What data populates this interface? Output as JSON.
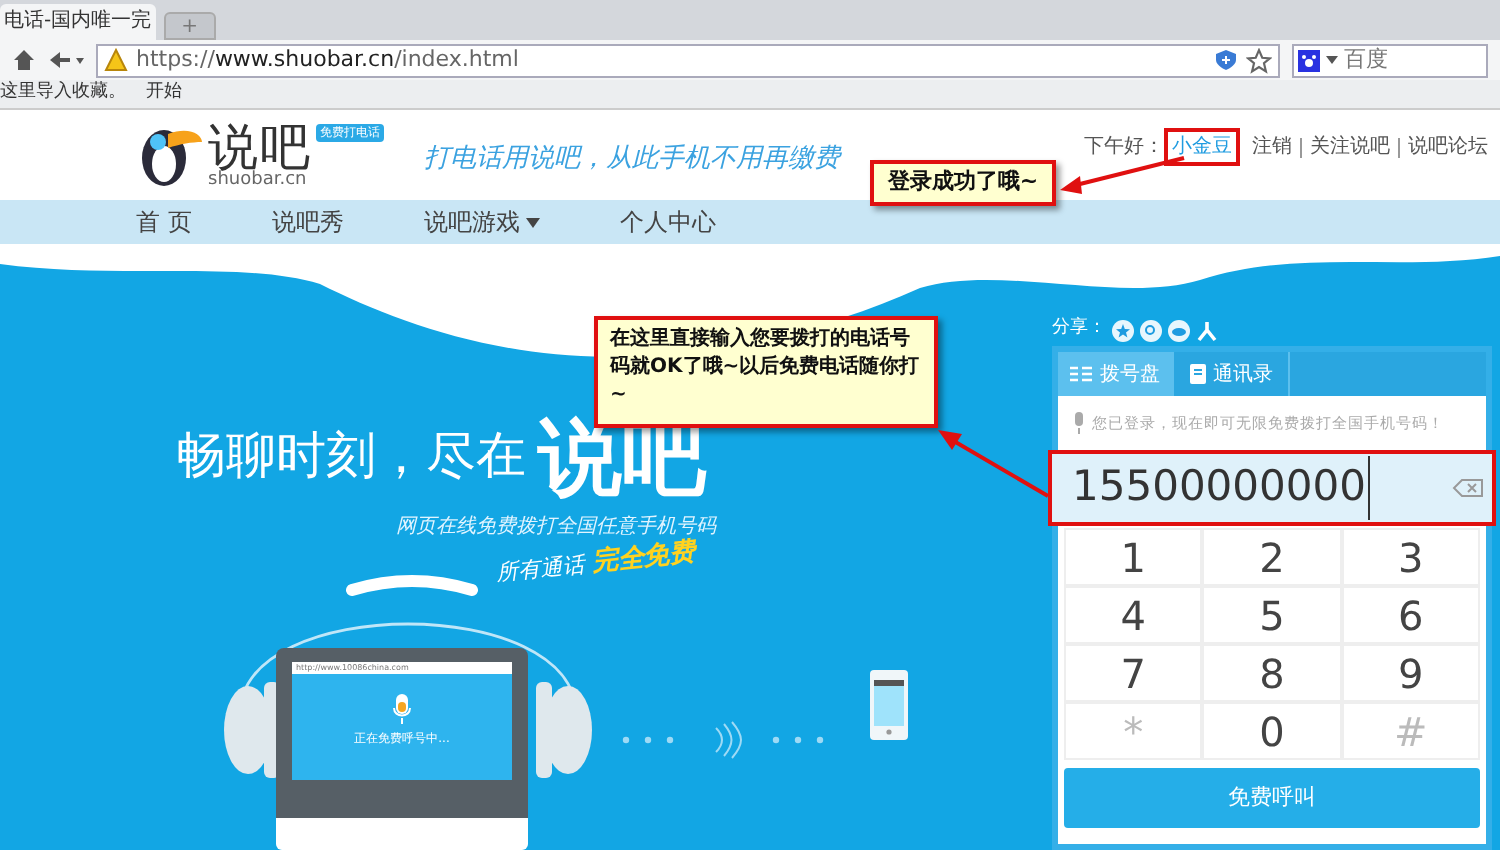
{
  "browser": {
    "tabs": [
      {
        "label": "电话-国内唯一完",
        "selected": true
      },
      {
        "label": "+",
        "selected": false
      }
    ],
    "url": "https://**www.shuobar.cn**/index.html",
    "search_engine": "百度",
    "bookmarks": [
      "这里导入收藏。",
      "开始"
    ]
  },
  "header": {
    "logo_text": "说吧",
    "logo_domain": "shuobar.cn",
    "badge": "免费打电话",
    "slogan": "打电话用说吧，从此手机不用再缴费",
    "greeting": "下午好：",
    "username": "小金豆",
    "links": [
      "注销",
      "关注说吧",
      "说吧论坛"
    ]
  },
  "nav": [
    {
      "label": "首 页",
      "dropdown": false
    },
    {
      "label": "说吧秀",
      "dropdown": false
    },
    {
      "label": "说吧游戏",
      "dropdown": true
    },
    {
      "label": "个人中心",
      "dropdown": false
    }
  ],
  "hero": {
    "headline": "畅聊时刻，尽在",
    "brand": "说吧",
    "subtitle": "网页在线免费拨打全国任意手机号码",
    "tagline": "所有通话",
    "tagline_highlight": "完全免费",
    "screen_url": "http://www.10086china.com",
    "screen_status": "正在免费呼号中..."
  },
  "dialer": {
    "share_label": "分享：",
    "tabs": [
      {
        "label": "拨号盘",
        "selected": true
      },
      {
        "label": "通讯录",
        "selected": false
      }
    ],
    "hint": "您已登录，现在即可无限免费拨打全国手机号码！",
    "number": "15500000000",
    "keys": [
      {
        "label": "1",
        "kind": "digit"
      },
      {
        "label": "2",
        "kind": "digit"
      },
      {
        "label": "3",
        "kind": "digit"
      },
      {
        "label": "4",
        "kind": "digit"
      },
      {
        "label": "5",
        "kind": "digit"
      },
      {
        "label": "6",
        "kind": "digit"
      },
      {
        "label": "7",
        "kind": "digit"
      },
      {
        "label": "8",
        "kind": "digit"
      },
      {
        "label": "9",
        "kind": "digit"
      },
      {
        "label": "*",
        "kind": "symbol"
      },
      {
        "label": "0",
        "kind": "digit"
      },
      {
        "label": "#",
        "kind": "symbol"
      }
    ],
    "call_button": "免费呼叫"
  },
  "annotations": {
    "login": "登录成功了哦~",
    "input": "在这里直接输入您要拨打的电话号码就OK了哦~以后免费电话随你打~"
  }
}
